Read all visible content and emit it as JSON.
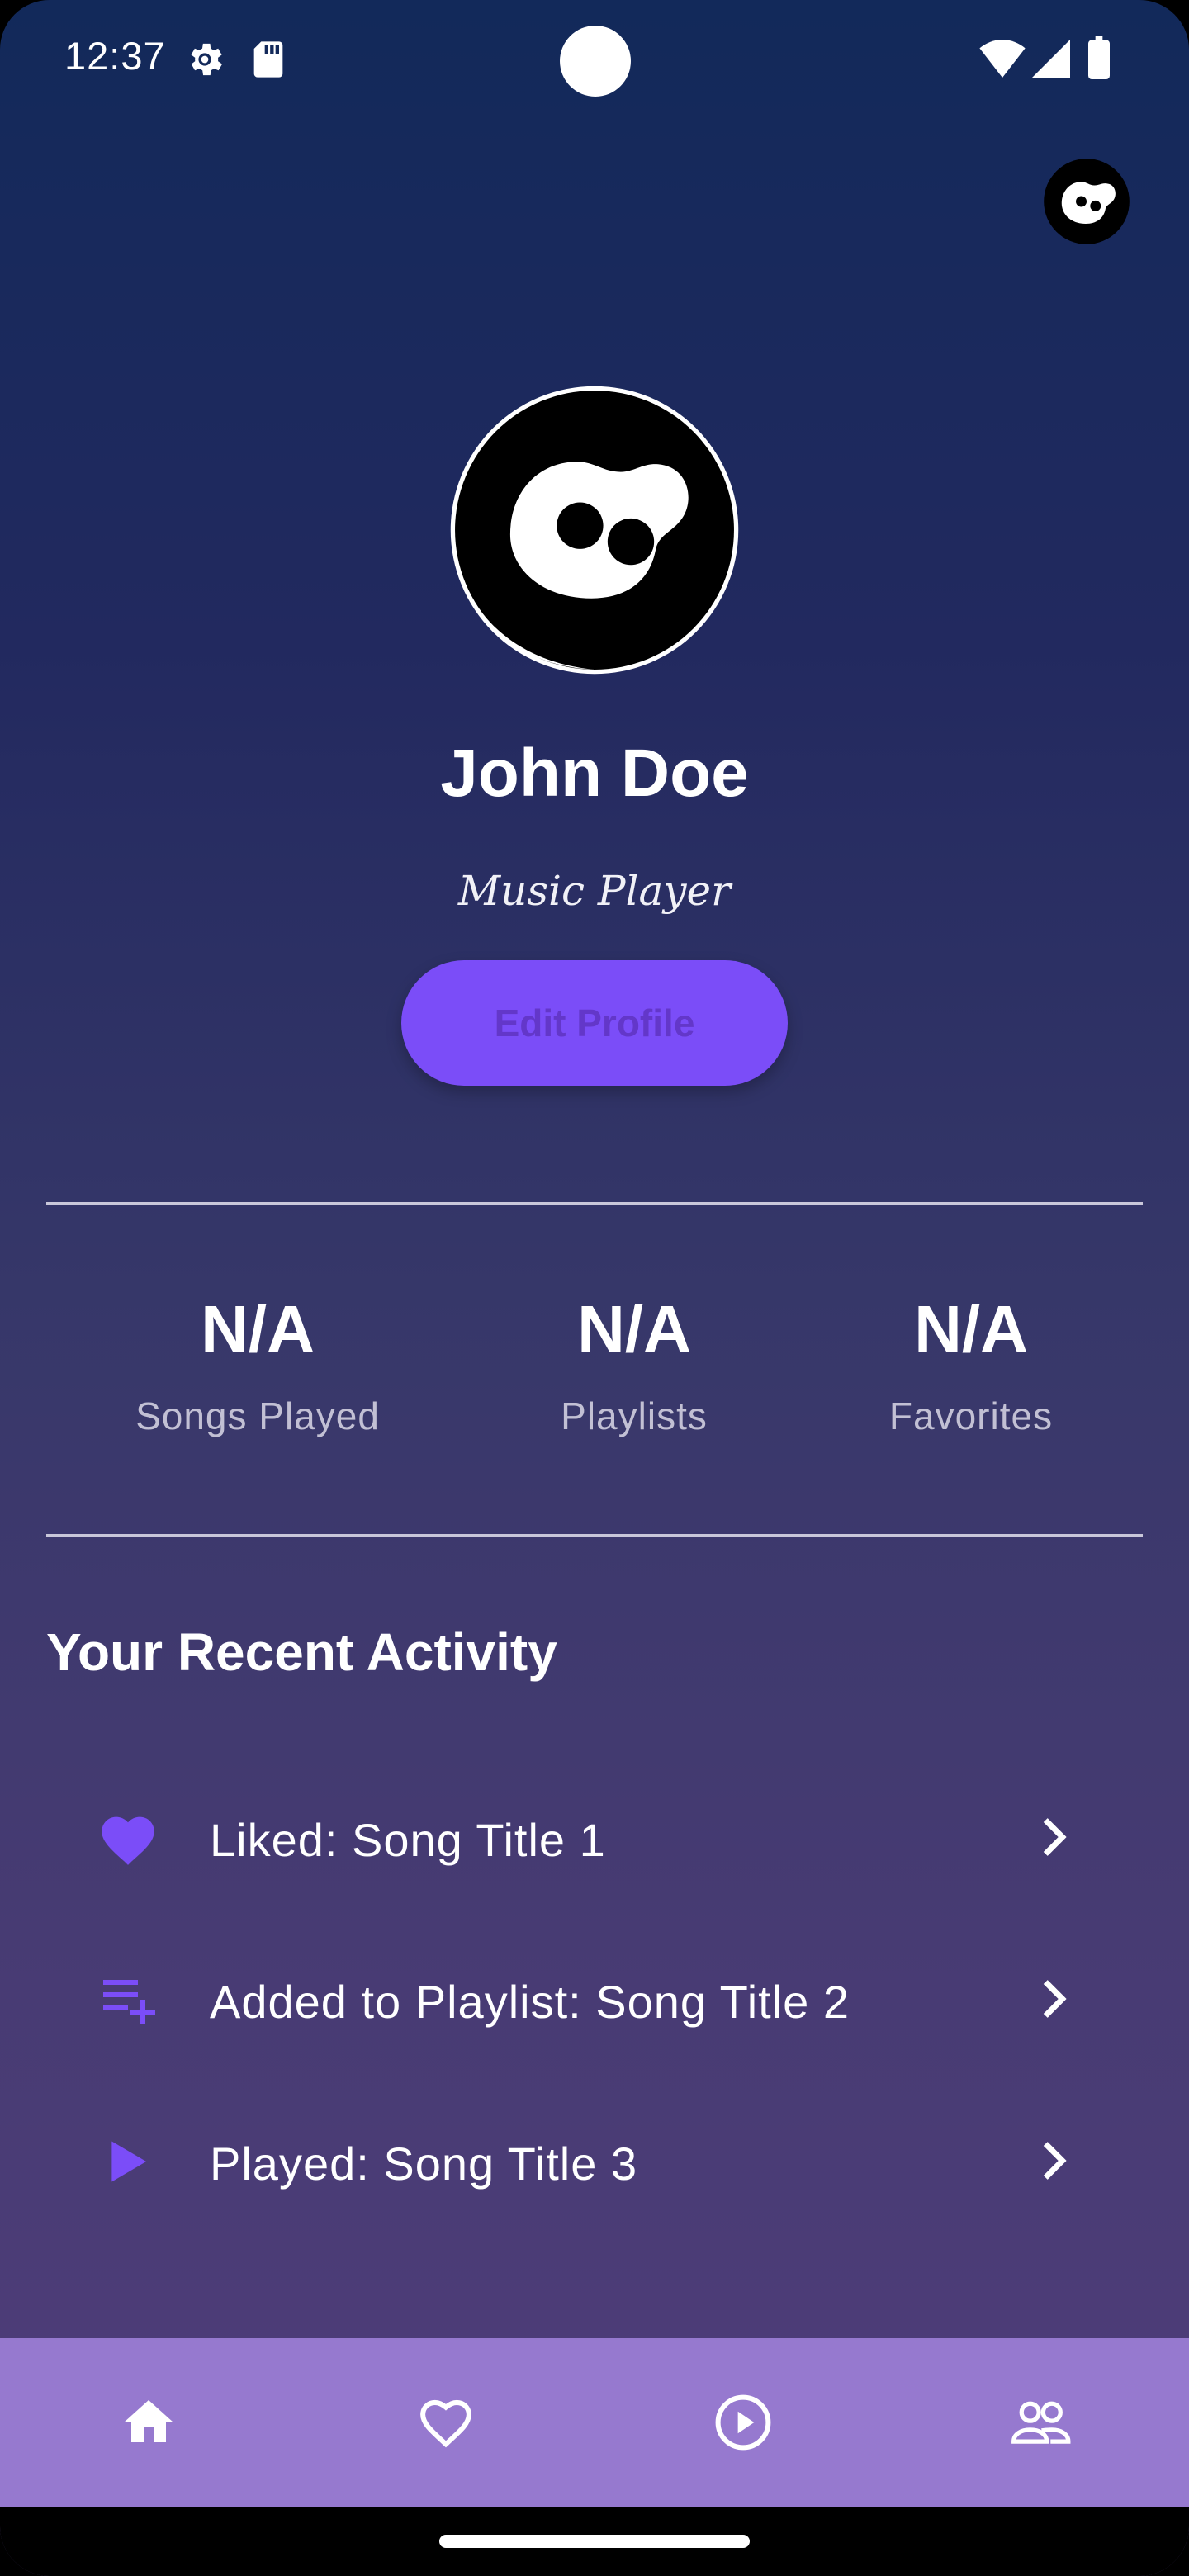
{
  "status_bar": {
    "time": "12:37",
    "icons": [
      "settings-gear-icon",
      "sd-card-icon",
      "wifi-icon",
      "cellular-signal-icon",
      "battery-icon"
    ]
  },
  "header": {
    "avatar_icon": "app-logo-avatar-icon"
  },
  "profile": {
    "name": "John Doe",
    "subtitle": "Music Player",
    "edit_button": "Edit Profile",
    "avatar_icon": "app-logo-avatar-icon"
  },
  "stats": [
    {
      "value": "N/A",
      "label": "Songs Played"
    },
    {
      "value": "N/A",
      "label": "Playlists"
    },
    {
      "value": "N/A",
      "label": "Favorites"
    }
  ],
  "recent_activity": {
    "title": "Your Recent Activity",
    "items": [
      {
        "icon": "heart-icon",
        "text": "Liked: Song Title 1"
      },
      {
        "icon": "playlist-add-icon",
        "text": "Added to Playlist: Song Title 2"
      },
      {
        "icon": "play-icon",
        "text": "Played: Song Title 3"
      }
    ]
  },
  "bottom_nav": {
    "items": [
      {
        "icon": "home-icon"
      },
      {
        "icon": "heart-outline-icon"
      },
      {
        "icon": "play-circle-icon"
      },
      {
        "icon": "people-icon"
      }
    ]
  },
  "colors": {
    "accent": "#7b4df8",
    "gradient_top": "#12295a",
    "gradient_bottom": "#4f3d7a",
    "nav_background": "#9679cf",
    "muted_text": "#c2c0d4"
  }
}
